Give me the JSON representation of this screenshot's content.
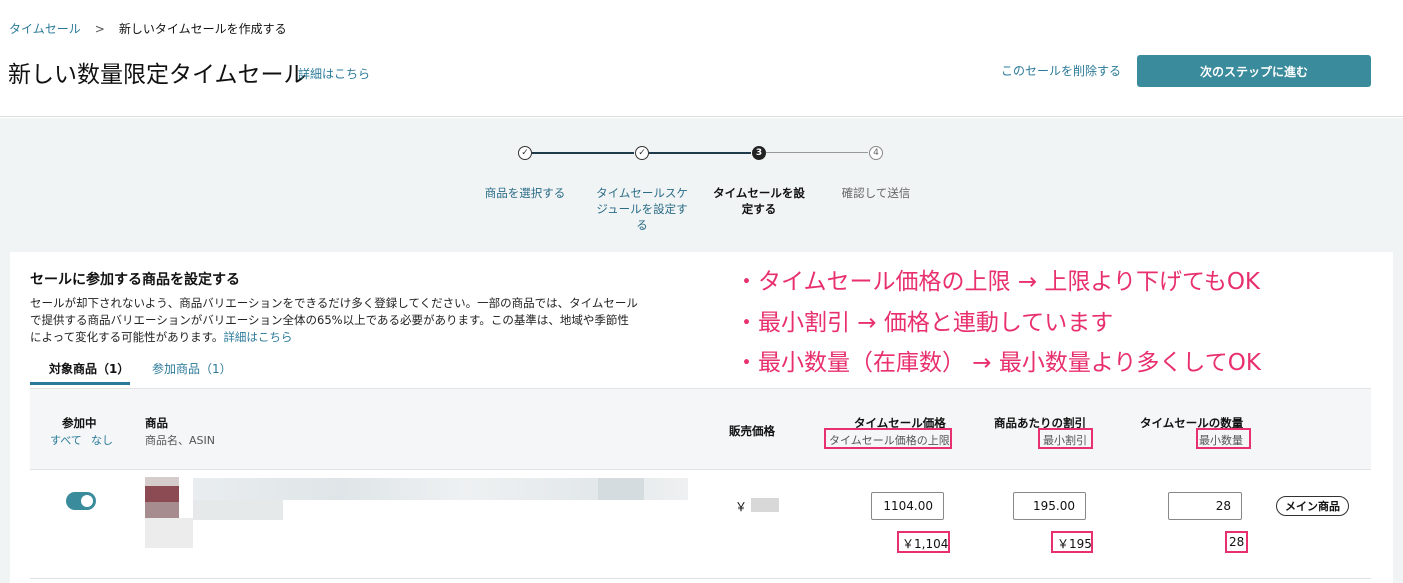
{
  "breadcrumb": {
    "root": "タイムセール",
    "separator": ">",
    "current": "新しいタイムセールを作成する"
  },
  "header": {
    "title": "新しい数量限定タイムセール",
    "details_link": "詳細はこちら",
    "delete_link": "このセールを削除する",
    "next_button": "次のステップに進む"
  },
  "steps": [
    {
      "marker": "✓",
      "label": "商品を選択する",
      "state": "done"
    },
    {
      "marker": "✓",
      "label": "タイムセールスケジュールを設定する",
      "state": "done"
    },
    {
      "marker": "3",
      "label": "タイムセールを設定する",
      "state": "active"
    },
    {
      "marker": "4",
      "label": "確認して送信",
      "state": "todo"
    }
  ],
  "section": {
    "title": "セールに参加する商品を設定する",
    "description": "セールが却下されないよう、商品バリエーションをできるだけ多く登録してください。一部の商品では、タイムセールで提供する商品バリエーションがバリエーション全体の65%以上である必要があります。この基準は、地域や季節性によって変化する可能性があります。",
    "details_link": "詳細はこちら"
  },
  "tabs": [
    {
      "label": "対象商品（1）",
      "active": true
    },
    {
      "label": "参加商品（1）",
      "active": false
    }
  ],
  "table": {
    "headers": {
      "participating": "参加中",
      "select_all": "すべて",
      "select_none": "なし",
      "product": "商品",
      "product_sub": "商品名、ASIN",
      "sale_price": "販売価格",
      "deal_price": "タイムセール価格",
      "deal_price_sub": "タイムセール価格の上限",
      "discount": "商品あたりの割引",
      "discount_sub": "最小割引",
      "quantity": "タイムセールの数量",
      "quantity_sub": "最小数量"
    },
    "rows": [
      {
        "participating": true,
        "price_prefix": "￥",
        "deal_price_input": "1104.00",
        "deal_price_max": "￥1,104",
        "discount_input": "195.00",
        "discount_min": "￥195",
        "quantity_input": "28",
        "quantity_min": "28",
        "badge": "メイン商品"
      }
    ]
  },
  "annotations": [
    "・タイムセール価格の上限 → 上限より下げてもOK",
    "・最小割引 → 価格と連動しています",
    "・最小数量（在庫数） → 最小数量より多くしてOK"
  ],
  "colors": {
    "accent": "#3a8b9c",
    "link": "#2b7a99",
    "annotation": "#e8306e"
  }
}
